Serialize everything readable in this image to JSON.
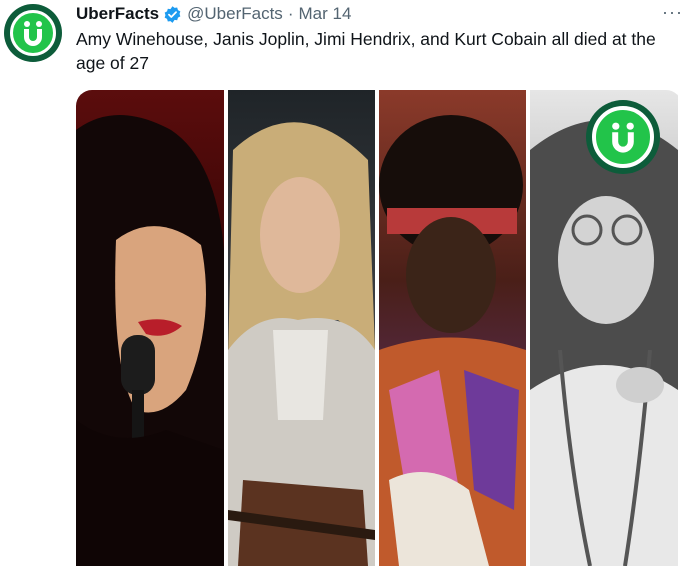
{
  "tweet": {
    "display_name": "UberFacts",
    "handle": "@UberFacts",
    "separator": "·",
    "date": "Mar 14",
    "more": "···",
    "text": "Amy Winehouse, Janis Joplin, Jimi Hendrix, and Kurt Cobain all died at the age of 27"
  },
  "media": {
    "panels": [
      "amy-winehouse-photo",
      "kurt-cobain-photo",
      "jimi-hendrix-photo",
      "janis-joplin-photo"
    ]
  },
  "colors": {
    "brand_green": "#22c44a",
    "brand_dark": "#0d5c3a",
    "verified_blue": "#1d9bf0",
    "secondary_text": "#536471"
  }
}
